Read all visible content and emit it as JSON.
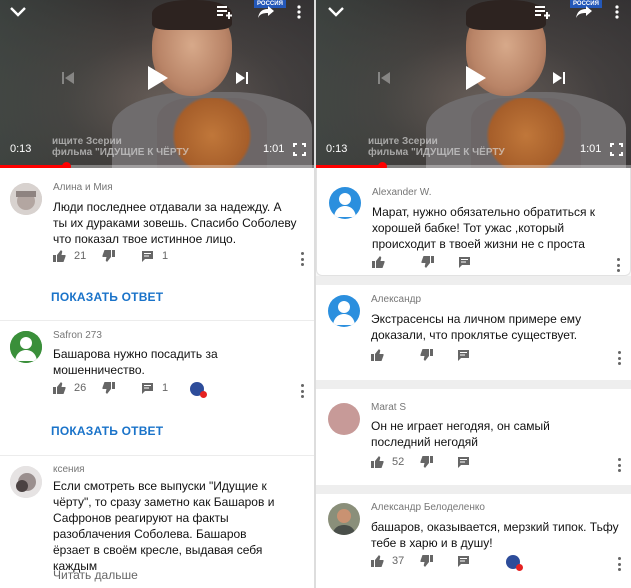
{
  "left": {
    "player": {
      "current_time": "0:13",
      "duration": "1:01",
      "progress": 0.21,
      "ticker_line1": "ищите Зсерии",
      "ticker_line2": "фильма  \"ИДУЩИЕ К ЧЁРТУ",
      "logo": "РОССИЯ"
    },
    "comments": [
      {
        "author": "Алина и Мия",
        "text": "Люди последнее отдавали за надежду.   А ты их дураками зовешь.   Спасибо Соболеву что показал твое истинное лицо.",
        "likes": "21",
        "replies": "1",
        "reply_button": "ПОКАЗАТЬ ОТВЕТ"
      },
      {
        "author": "Safron 273",
        "text": "Башарова нужно посадить за мошенничество.",
        "likes": "26",
        "replies": "1",
        "reply_button": "ПОКАЗАТЬ ОТВЕТ"
      },
      {
        "author": "ксения",
        "text": "Если смотреть все выпуски \"Идущие к чёрту\", то сразу заметно как Башаров и Сафронов реагируют на факты разоблачения Соболева. Башаров ёрзает в своём кресле, выдавая себя каждым",
        "read_more": "Читать дальше"
      }
    ]
  },
  "right": {
    "player": {
      "current_time": "0:13",
      "duration": "1:01",
      "progress": 0.21,
      "ticker_line1": "ищите Зсерии",
      "ticker_line2": "фильма  \"ИДУЩИЕ К ЧЁРТУ",
      "logo": "РОССИЯ"
    },
    "comments": [
      {
        "author": "Alexander W.",
        "text": "Марат, нужно обязательно обратиться к хорошей бабке! Тот ужас ,который происходит в твоей жизни не с проста"
      },
      {
        "author": "Александр",
        "text": "Экстрасенсы на личном примере ему доказали, что проклятье существует."
      },
      {
        "author": "Marat S",
        "text": "Он не играет негодяя, он самый последний негодяй",
        "likes": "52"
      },
      {
        "author": "Александр Белоделенко",
        "text": "башаров, оказывается, мерзкий типок. Тьфу тебе в харю и в душу!",
        "likes": "37"
      }
    ]
  },
  "colors": {
    "accent_red": "#ff0000",
    "link_blue": "#1a73c9",
    "avatar_blue": "#2b8fde"
  }
}
